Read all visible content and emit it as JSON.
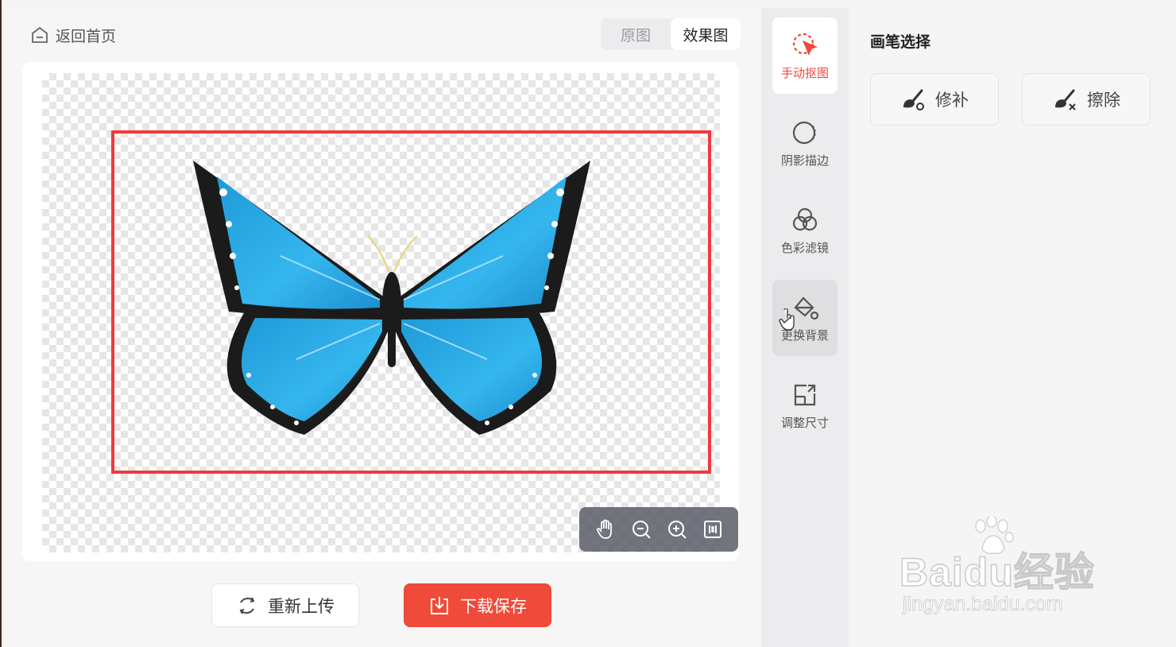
{
  "header": {
    "back_label": "返回首页",
    "view_toggle": {
      "original": "原图",
      "result": "效果图",
      "selected": "效果图"
    }
  },
  "tools": [
    {
      "label": "手动抠图",
      "icon": "cursor-click-icon",
      "active": true
    },
    {
      "label": "阴影描边",
      "icon": "shadow-circle-icon",
      "active": false
    },
    {
      "label": "色彩滤镜",
      "icon": "color-filter-icon",
      "active": false
    },
    {
      "label": "更换背景",
      "icon": "paint-bucket-icon",
      "active": false
    },
    {
      "label": "调整尺寸",
      "icon": "resize-icon",
      "active": false
    }
  ],
  "brush_panel": {
    "title": "画笔选择",
    "repair_label": "修补",
    "erase_label": "擦除"
  },
  "actions": {
    "reupload_label": "重新上传",
    "download_label": "下载保存"
  },
  "colors": {
    "accent": "#ef4a3a",
    "selection_border": "#ef3a3f",
    "butterfly_blue": "#29a9e6"
  },
  "watermark": {
    "brand": "Baidu经验",
    "url": "jingyan.baidu.com"
  }
}
